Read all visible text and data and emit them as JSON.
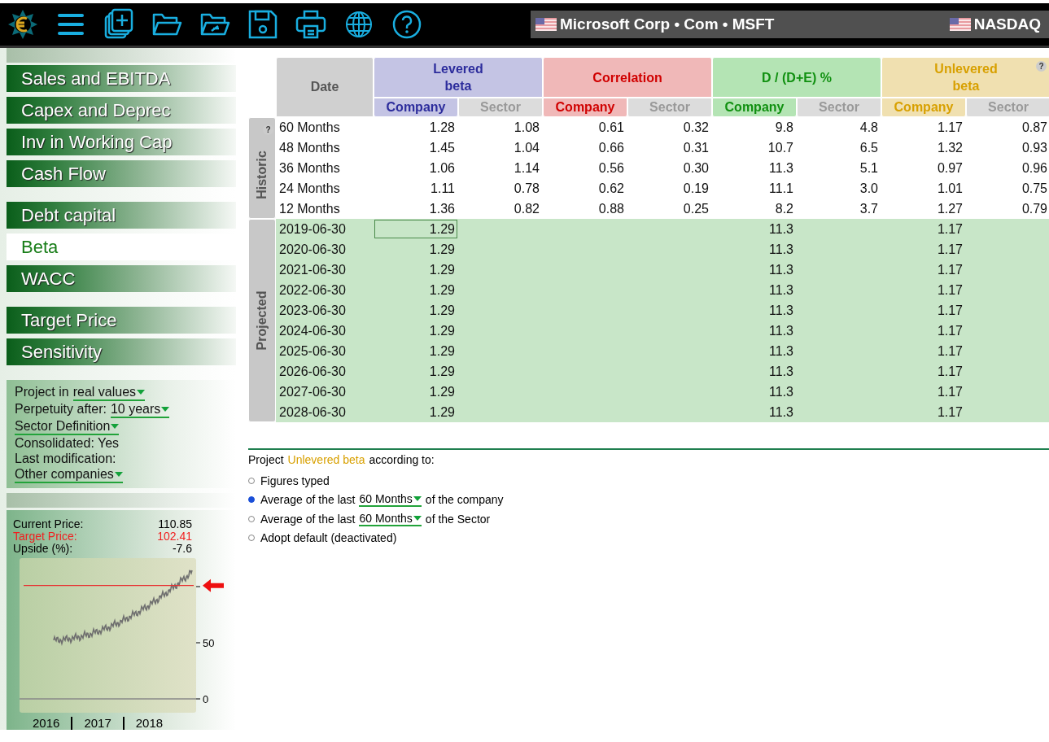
{
  "toolbar": {
    "company": "Microsoft Corp • Com • MSFT",
    "exchange": "NASDAQ"
  },
  "sidebar": {
    "groups": [
      [
        {
          "label": "Sales and EBITDA",
          "selected": false
        },
        {
          "label": "Capex and Deprec",
          "selected": false
        },
        {
          "label": "Inv in Working Cap",
          "selected": false
        },
        {
          "label": "Cash Flow",
          "selected": false
        }
      ],
      [
        {
          "label": "Debt capital",
          "selected": false
        },
        {
          "label": "Beta",
          "selected": true
        },
        {
          "label": "WACC",
          "selected": false
        }
      ],
      [
        {
          "label": "Target Price",
          "selected": false
        },
        {
          "label": "Sensitivity",
          "selected": false
        }
      ]
    ]
  },
  "settings": [
    {
      "kind": "dropdown",
      "label": "Project in",
      "value": "real values"
    },
    {
      "kind": "dropdown",
      "label": "Perpetuity after:",
      "value": "10 years"
    },
    {
      "kind": "dropdown",
      "value": "Sector Definition"
    },
    {
      "kind": "text",
      "label": "Consolidated: Yes"
    },
    {
      "kind": "text",
      "label": "Last modification:"
    },
    {
      "kind": "dropdown",
      "value": "Other companies"
    }
  ],
  "prices": [
    {
      "kind": "plain",
      "label": "Current Price:",
      "value": "110.85"
    },
    {
      "kind": "target",
      "label": "Target Price:",
      "value": "102.41"
    },
    {
      "kind": "plain",
      "label": "Upside (%):",
      "value": "-7.6"
    }
  ],
  "price_chart": {
    "y_labels": [
      "50",
      "0"
    ],
    "x_labels": [
      "2016",
      "2017",
      "2018"
    ]
  },
  "table": {
    "date_header": "Date",
    "help": "?",
    "groups": [
      {
        "kind": "levered",
        "title_lines": [
          "Levered",
          "beta"
        ],
        "sub": [
          "Company",
          "Sector"
        ]
      },
      {
        "kind": "correlation",
        "title_lines": [
          "Correlation"
        ],
        "sub": [
          "Company",
          "Sector"
        ]
      },
      {
        "kind": "debt",
        "title_lines": [
          "D / (D+E) %"
        ],
        "sub": [
          "Company",
          "Sector"
        ]
      },
      {
        "kind": "unlevered",
        "title_lines": [
          "Unlevered",
          "beta"
        ],
        "sub": [
          "Company",
          "Sector"
        ]
      }
    ],
    "sections": [
      {
        "kind": "historic",
        "label": "Historic",
        "help": "?",
        "rows": [
          {
            "date": "60 Months",
            "selected": false,
            "cells": [
              "1.28",
              "1.08",
              "0.61",
              "0.32",
              "9.8",
              "4.8",
              "1.17",
              "0.87"
            ]
          },
          {
            "date": "48 Months",
            "selected": false,
            "cells": [
              "1.45",
              "1.04",
              "0.66",
              "0.31",
              "10.7",
              "6.5",
              "1.32",
              "0.93"
            ]
          },
          {
            "date": "36 Months",
            "selected": false,
            "cells": [
              "1.06",
              "1.14",
              "0.56",
              "0.30",
              "11.3",
              "5.1",
              "0.97",
              "0.96"
            ]
          },
          {
            "date": "24 Months",
            "selected": false,
            "cells": [
              "1.11",
              "0.78",
              "0.62",
              "0.19",
              "11.1",
              "3.0",
              "1.01",
              "0.75"
            ]
          },
          {
            "date": "12 Months",
            "selected": false,
            "cells": [
              "1.36",
              "0.82",
              "0.88",
              "0.25",
              "8.2",
              "3.7",
              "1.27",
              "0.79"
            ]
          }
        ]
      },
      {
        "kind": "projected",
        "label": "Projected",
        "rows": [
          {
            "date": "2019-06-30",
            "selected": true,
            "cells": [
              "1.29",
              null,
              null,
              null,
              "11.3",
              null,
              "1.17",
              null
            ]
          },
          {
            "date": "2020-06-30",
            "selected": false,
            "cells": [
              "1.29",
              null,
              null,
              null,
              "11.3",
              null,
              "1.17",
              null
            ]
          },
          {
            "date": "2021-06-30",
            "selected": false,
            "cells": [
              "1.29",
              null,
              null,
              null,
              "11.3",
              null,
              "1.17",
              null
            ]
          },
          {
            "date": "2022-06-30",
            "selected": false,
            "cells": [
              "1.29",
              null,
              null,
              null,
              "11.3",
              null,
              "1.17",
              null
            ]
          },
          {
            "date": "2023-06-30",
            "selected": false,
            "cells": [
              "1.29",
              null,
              null,
              null,
              "11.3",
              null,
              "1.17",
              null
            ]
          },
          {
            "date": "2024-06-30",
            "selected": false,
            "cells": [
              "1.29",
              null,
              null,
              null,
              "11.3",
              null,
              "1.17",
              null
            ]
          },
          {
            "date": "2025-06-30",
            "selected": false,
            "cells": [
              "1.29",
              null,
              null,
              null,
              "11.3",
              null,
              "1.17",
              null
            ]
          },
          {
            "date": "2026-06-30",
            "selected": false,
            "cells": [
              "1.29",
              null,
              null,
              null,
              "11.3",
              null,
              "1.17",
              null
            ]
          },
          {
            "date": "2027-06-30",
            "selected": false,
            "cells": [
              "1.29",
              null,
              null,
              null,
              "11.3",
              null,
              "1.17",
              null
            ]
          },
          {
            "date": "2028-06-30",
            "selected": false,
            "cells": [
              "1.29",
              null,
              null,
              null,
              "11.3",
              null,
              "1.17",
              null
            ]
          }
        ]
      }
    ]
  },
  "projection": {
    "intro_before": "Project",
    "intro_highlight": "Unlevered beta",
    "intro_after": "according to:",
    "options": [
      {
        "selected": false,
        "parts": [
          {
            "kind": "text",
            "text": "Figures typed"
          }
        ]
      },
      {
        "selected": true,
        "parts": [
          {
            "kind": "text",
            "text": "Average of the last"
          },
          {
            "kind": "dropdown",
            "text": "60 Months"
          },
          {
            "kind": "text",
            "text": "of the company"
          }
        ]
      },
      {
        "selected": false,
        "parts": [
          {
            "kind": "text",
            "text": "Average of the last"
          },
          {
            "kind": "dropdown",
            "text": "60 Months"
          },
          {
            "kind": "text",
            "text": "of the Sector"
          }
        ]
      },
      {
        "selected": false,
        "parts": [
          {
            "kind": "text",
            "text": "Adopt default (deactivated)"
          }
        ]
      }
    ]
  }
}
